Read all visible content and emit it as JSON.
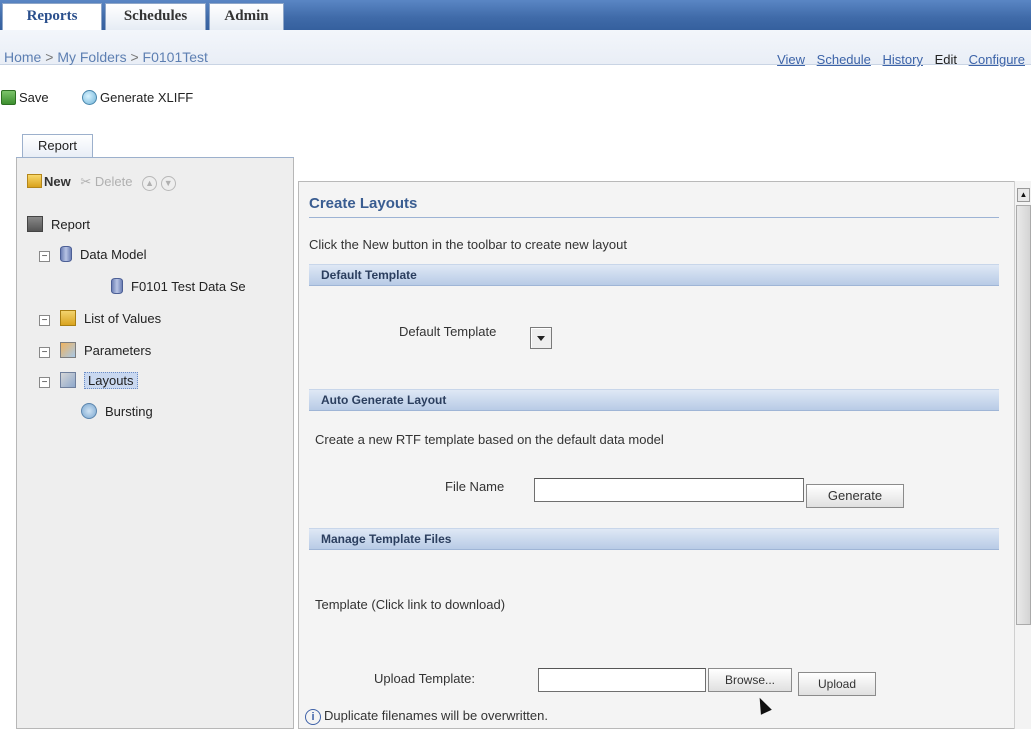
{
  "top_tabs": [
    {
      "label": "Reports",
      "active": true
    },
    {
      "label": "Schedules",
      "active": false
    },
    {
      "label": "Admin",
      "active": false
    }
  ],
  "breadcrumb": {
    "items": [
      "Home",
      "My Folders",
      "F0101Test"
    ],
    "separator": ">"
  },
  "view_links": [
    {
      "label": "View",
      "link": true
    },
    {
      "label": "Schedule",
      "link": true
    },
    {
      "label": "History",
      "link": true
    },
    {
      "label": "Edit",
      "link": false
    },
    {
      "label": "Configure",
      "link": true
    }
  ],
  "toolbar": {
    "save_label": "Save",
    "generate_xliff_label": "Generate XLIFF"
  },
  "left": {
    "tab_label": "Report",
    "tools": {
      "new_label": "New",
      "delete_label": "Delete"
    },
    "tree": {
      "root": "Report",
      "data_model": "Data Model",
      "data_set": "F0101 Test Data Se",
      "list_of_values": "List of Values",
      "parameters": "Parameters",
      "layouts": "Layouts",
      "bursting": "Bursting"
    }
  },
  "main": {
    "title": "Create Layouts",
    "intro": "Click the New button in the toolbar to create new layout",
    "default_template": {
      "section": "Default Template",
      "label": "Default Template",
      "value": ""
    },
    "auto_generate": {
      "section": "Auto Generate Layout",
      "description": "Create a new RTF template based on the default data model",
      "file_name_label": "File Name",
      "file_name_value": "",
      "generate_label": "Generate"
    },
    "manage": {
      "section": "Manage Template Files",
      "template_hint": "Template (Click link to download)",
      "upload_label": "Upload Template:",
      "upload_value": "",
      "browse_label": "Browse...",
      "upload_button": "Upload",
      "note": "Duplicate filenames will be overwritten."
    }
  },
  "colors": {
    "header_blue": "#3f6aa8",
    "section_bar": "#b8cbe6",
    "link": "#3c63a8"
  }
}
